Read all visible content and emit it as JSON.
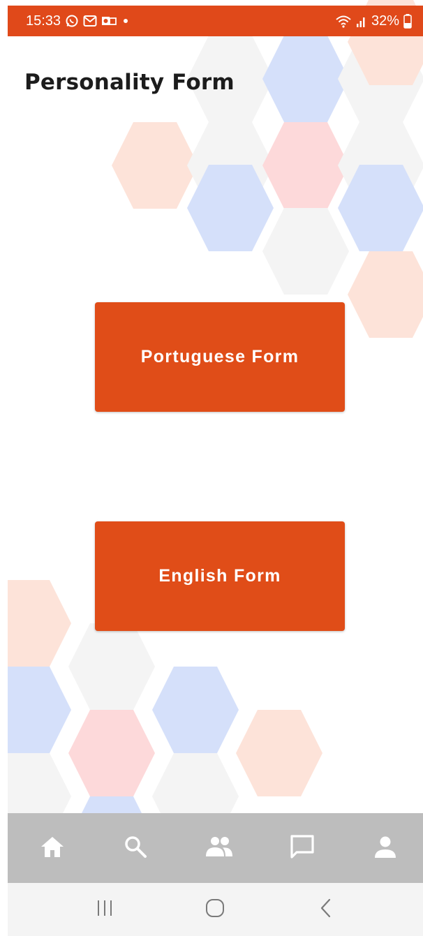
{
  "status_bar": {
    "time": "15:33",
    "battery": "32%",
    "left_icons": [
      "whatsapp-icon",
      "gmail-icon",
      "outlook-icon",
      "notification-dot-icon"
    ],
    "right_icons": [
      "wifi-icon",
      "signal-icon",
      "battery-icon"
    ]
  },
  "page": {
    "title": "Personality Form"
  },
  "buttons": {
    "portuguese": "Portuguese Form",
    "english": "English Form"
  },
  "bottom_nav": {
    "items": [
      "home-icon",
      "search-icon",
      "people-icon",
      "chat-icon",
      "profile-icon"
    ]
  },
  "system_nav": {
    "items": [
      "recents-icon",
      "home-circle-icon",
      "back-icon"
    ]
  },
  "colors": {
    "accent": "#e04d18",
    "status_bar": "#e0491a",
    "bottom_nav": "#bdbdbd",
    "system_nav": "#f4f4f4",
    "hex_orange": "#fde3d9",
    "hex_blue": "#d5e0fa",
    "hex_pink": "#fdd9da",
    "hex_gray": "#f4f4f4"
  }
}
